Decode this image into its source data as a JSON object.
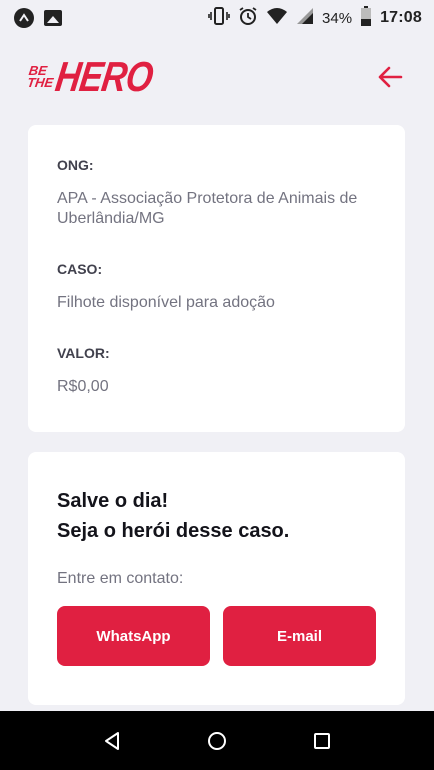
{
  "status_bar": {
    "battery_percent": "34%",
    "time": "17:08",
    "icons": [
      "app-a-icon",
      "image-icon",
      "vibrate-icon",
      "alarm-icon",
      "wifi-icon",
      "signal-icon",
      "battery-icon"
    ]
  },
  "header": {
    "logo_small_top": "BE",
    "logo_small_bottom": "THE",
    "logo_big": "HERO",
    "back_icon": "arrow-left-icon"
  },
  "incident": {
    "ong_label": "ONG:",
    "ong_value": "APA - Associação Protetora de Animais de Uberlândia/MG",
    "case_label": "CASO:",
    "case_value": "Filhote disponível para adoção",
    "value_label": "VALOR:",
    "value_value": "R$0,00"
  },
  "contact": {
    "title_line1": "Salve o dia!",
    "title_line2": "Seja o herói desse caso.",
    "description": "Entre em contato:",
    "whatsapp_label": "WhatsApp",
    "email_label": "E-mail"
  },
  "colors": {
    "accent": "#e02041",
    "background": "#f0f0f5",
    "card": "#ffffff",
    "label": "#41414d",
    "text": "#737380"
  },
  "nav_bar": {
    "icons": [
      "back-triangle-icon",
      "home-circle-icon",
      "recents-square-icon"
    ]
  }
}
